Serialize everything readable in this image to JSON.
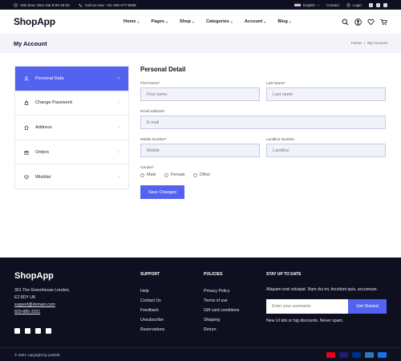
{
  "topbar": {
    "visit": "Visit time: Mon-Sat 8:00-18:00",
    "call": "Call us now: +01 035-477-5566",
    "language": "English",
    "contact": "Contact",
    "login": "Login"
  },
  "header": {
    "logo": "ShopApp",
    "nav": [
      "Home",
      "Pages",
      "Shop",
      "Categories",
      "Account",
      "Blog"
    ]
  },
  "titleband": {
    "title": "My Account",
    "crumbs": [
      "Home",
      "/",
      "My Account"
    ]
  },
  "account_menu": {
    "items": [
      {
        "label": "Personal Data",
        "icon": "user-icon"
      },
      {
        "label": "Change Password",
        "icon": "lock-icon"
      },
      {
        "label": "Address",
        "icon": "home-icon"
      },
      {
        "label": "Orders",
        "icon": "box-icon"
      },
      {
        "label": "Wishlist",
        "icon": "heart-icon"
      }
    ],
    "active_index": 0
  },
  "form": {
    "title": "Personal Detail",
    "first_name": {
      "label": "First Name*",
      "placeholder": "First name"
    },
    "last_name": {
      "label": "Last Name*",
      "placeholder": "Last name"
    },
    "email": {
      "label": "Email address*",
      "placeholder": "E-mail"
    },
    "mobile": {
      "label": "Mobile Number*",
      "placeholder": "Mobile"
    },
    "landline": {
      "label": "Landline Number",
      "placeholder": "Landline"
    },
    "gender_label": "Gender*",
    "genders": [
      "Male",
      "Female",
      "Other"
    ],
    "save": "Save Changes"
  },
  "footer": {
    "logo": "ShopApp",
    "address": [
      "301 The Greenhouse London,",
      "E2 8DY UK"
    ],
    "email": "support@domain.com",
    "phone": "820-885-3321",
    "support": {
      "heading": "SUPPORT",
      "links": [
        "Help",
        "Contact Us",
        "Feedback",
        "Unsubscribe",
        "Reservations"
      ]
    },
    "policies": {
      "heading": "POLICIES",
      "links": [
        "Privacy Policy",
        "Terms of use",
        "Gift card conditions",
        "Shipping",
        "Return"
      ]
    },
    "newsletter": {
      "heading": "STAY UP TO DATE",
      "text": "Aliquam erat volutpat. Nam dui mi, tincidunt quis, accumsan.",
      "placeholder": "Enter your username",
      "button": "Get Started",
      "note": "New UI kits or big discounts. Never spam."
    },
    "copyright": "© 2021 copyright by pxdraft",
    "payment_colors": [
      "#eb001b",
      "#1a1f71",
      "#003087",
      "#2e77bb",
      "#1a73e8"
    ]
  }
}
